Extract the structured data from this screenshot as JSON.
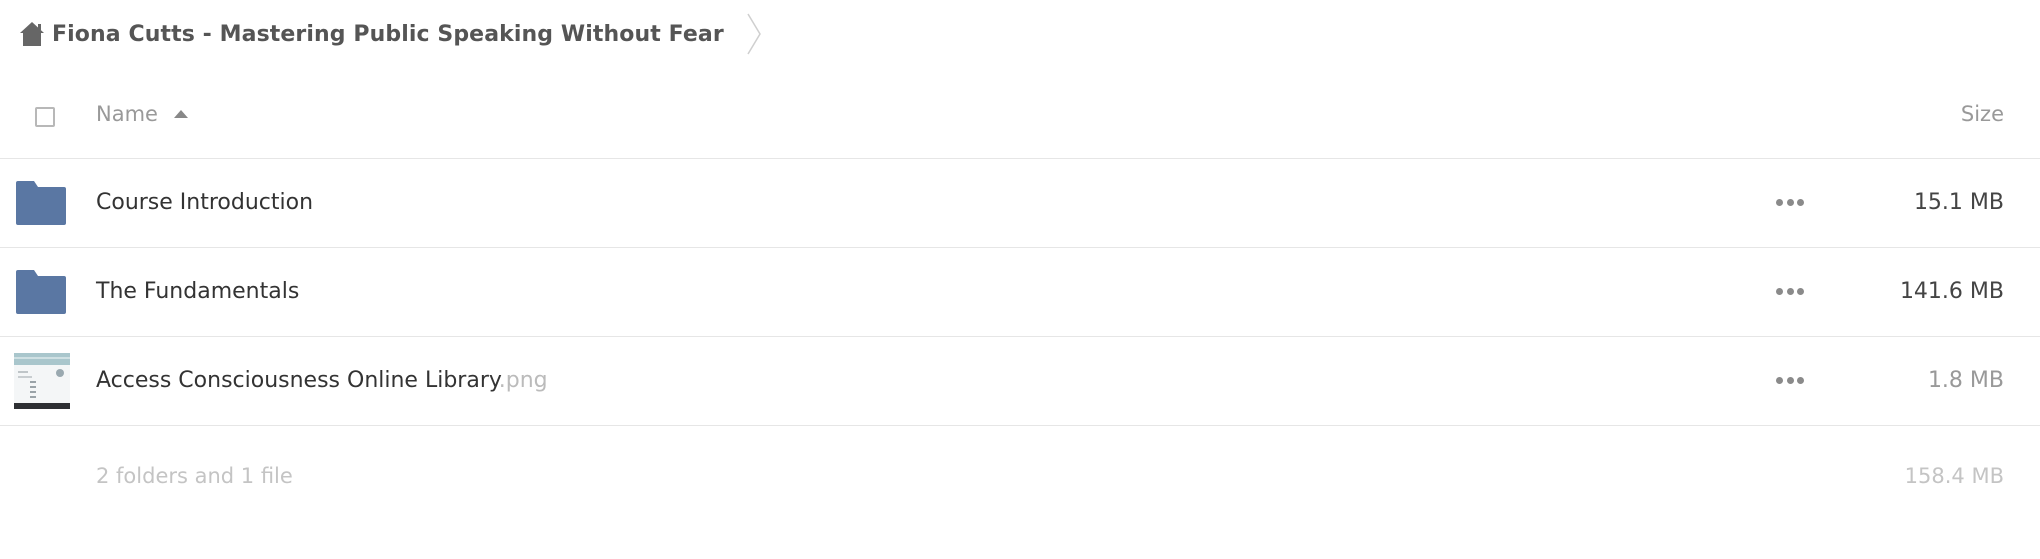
{
  "breadcrumb": {
    "home_icon": "home-icon",
    "current_folder": "Fiona Cutts - Mastering Public Speaking Without Fear"
  },
  "table": {
    "header": {
      "name_label": "Name",
      "size_label": "Size",
      "sort": "ascending"
    },
    "rows": [
      {
        "type": "folder",
        "icon": "folder-icon",
        "name": "Course Introduction",
        "ext": "",
        "size": "15.1 MB"
      },
      {
        "type": "folder",
        "icon": "folder-icon",
        "name": "The Fundamentals",
        "ext": "",
        "size": "141.6 MB"
      },
      {
        "type": "file",
        "icon": "image-thumbnail",
        "name": "Access Consciousness Online Library",
        "ext": ".png",
        "size": "1.8 MB"
      }
    ],
    "footer": {
      "summary": "2 folders and 1 file",
      "total_size": "158.4 MB"
    }
  },
  "colors": {
    "folder": "#5a77a3",
    "text": "#333333",
    "muted": "#c4c4c4",
    "divider": "#e6e6e6"
  }
}
